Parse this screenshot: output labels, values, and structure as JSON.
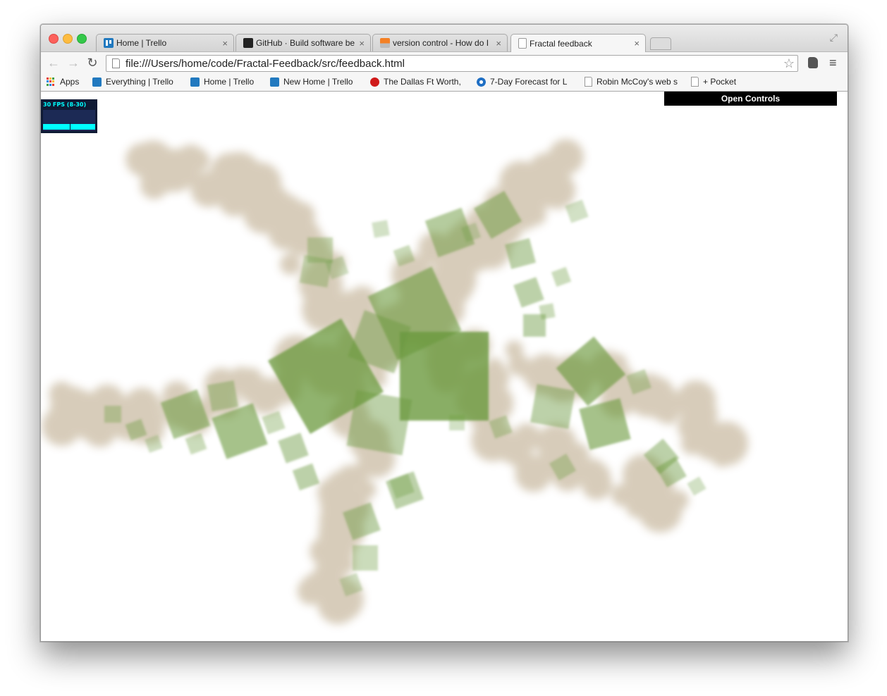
{
  "window": {
    "tabs": [
      {
        "label": "Home | Trello",
        "icon": "trello-icon",
        "active": false
      },
      {
        "label": "GitHub · Build software better",
        "icon": "github-icon",
        "active": false
      },
      {
        "label": "version control - How do I",
        "icon": "stackoverflow-icon",
        "active": false
      },
      {
        "label": "Fractal feedback",
        "icon": "page-icon",
        "active": true
      }
    ],
    "tab_close_glyph": "×"
  },
  "toolbar": {
    "url": "file:///Users/home/code/Fractal-Feedback/src/feedback.html"
  },
  "bookmarks": [
    {
      "label": "Apps",
      "icon": "apps-icon"
    },
    {
      "label": "Everything | Trello",
      "icon": "trello-icon"
    },
    {
      "label": "Home | Trello",
      "icon": "trello-icon"
    },
    {
      "label": "New Home | Trello",
      "icon": "trello-icon"
    },
    {
      "label": "The Dallas Ft Worth,",
      "icon": "dallas-icon"
    },
    {
      "label": "7-Day Forecast for L",
      "icon": "noaa-icon"
    },
    {
      "label": "Robin McCoy's web s",
      "icon": "page-icon"
    },
    {
      "label": "+ Pocket",
      "icon": "page-icon"
    }
  ],
  "page": {
    "fps_text": "30 FPS (8-30)",
    "open_controls_label": "Open Controls"
  },
  "colors": {
    "square": "#6b9a3e",
    "haze": "#a89068",
    "fps_accent": "#00ffff"
  }
}
